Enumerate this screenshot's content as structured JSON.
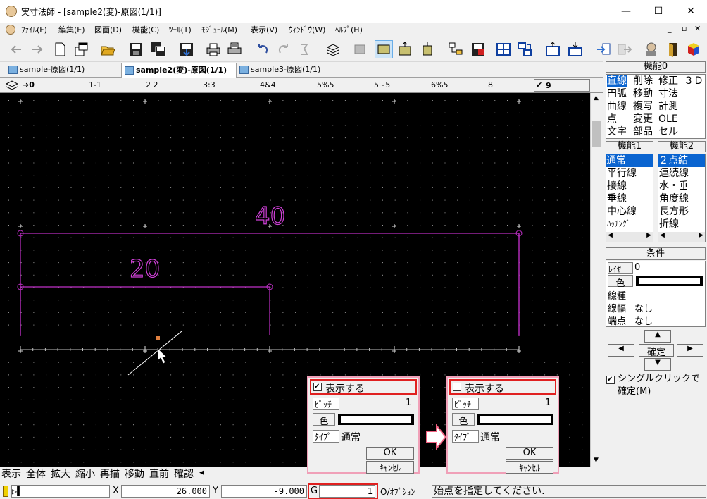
{
  "window": {
    "title": "実寸法師 - [sample2(変)-原図(1/1)]",
    "minimize_glyph": "—",
    "maximize_glyph": "☐",
    "close_glyph": "✕"
  },
  "menu": {
    "items": [
      "ﾌｧｲﾙ(F)",
      "編集(E)",
      "図面(D)",
      "機能(C)",
      "ﾂｰﾙ(T)",
      "ﾓｼﾞｭｰﾙ(M)",
      "表示(V)",
      "ｳｨﾝﾄﾞｳ(W)",
      "ﾍﾙﾌﾟ(H)"
    ],
    "mdi_controls": [
      "_",
      "▫",
      "✕"
    ]
  },
  "toolbar": {
    "icons": [
      "back-icon",
      "forward-icon",
      "new-icon",
      "new-window-icon",
      "open-icon",
      "save-icon",
      "save-all-icon",
      "export-icon",
      "print-icon",
      "print-preview-icon",
      "undo-icon",
      "redo-icon",
      "repeat-icon",
      "layers-icon",
      "fill-icon",
      "area-icon",
      "area-move-icon",
      "area-copy-icon",
      "tree-icon",
      "save-special-icon",
      "grid-icon",
      "hierarchy-icon",
      "window-up-icon",
      "window-down-icon",
      "import-icon",
      "send-icon",
      "user-icon",
      "exit-icon",
      "cube-icon"
    ]
  },
  "tabs": [
    {
      "label": "sample-原図(1/1)"
    },
    {
      "label": "sample2(変)-原図(1/1)"
    },
    {
      "label": "sample3-原図(1/1)"
    }
  ],
  "layers": {
    "items": [
      "0",
      "1-1",
      "2 2",
      "3:3",
      "4&4",
      "5%5",
      "5~5",
      "6%5",
      "8",
      "9"
    ],
    "current": "0",
    "checked": "9"
  },
  "drawing": {
    "dim_top": "40",
    "dim_inner": "20",
    "line_color": "#c030c8",
    "dim_color": "#d040d8"
  },
  "panel": {
    "func0": {
      "title": "機能0",
      "rows": [
        [
          "直線",
          "削除",
          "修正",
          "３Ｄ"
        ],
        [
          "円弧",
          "移動",
          "寸法",
          ""
        ],
        [
          "曲線",
          "複写",
          "計測",
          ""
        ],
        [
          "点",
          "変更",
          "OLE",
          ""
        ],
        [
          "文字",
          "部品",
          "セル",
          ""
        ]
      ]
    },
    "func1": {
      "title": "機能1",
      "items": [
        "通常",
        "平行線",
        "接線",
        "垂線",
        "中心線",
        "ﾊｯﾁﾝｸﾞ"
      ]
    },
    "func2": {
      "title": "機能2",
      "items": [
        "２点結",
        "連続線",
        "水・垂",
        "角度線",
        "長方形",
        "折線"
      ]
    },
    "cond": {
      "title": "条件",
      "layer_label": "ﾚｲﾔ",
      "layer_value": "0",
      "color_label": "色",
      "linetype_label": "線種",
      "linewidth_label": "線幅",
      "linewidth_value": "なし",
      "endpoint_label": "端点",
      "endpoint_value": "なし"
    },
    "nav": {
      "up": "▲",
      "left": "◀",
      "confirm": "確定",
      "right": "▶",
      "down": "▼"
    },
    "single_click": "シングルクリックで確定(M)"
  },
  "commands": [
    "表示",
    "全体",
    "拡大",
    "縮小",
    "再描",
    "移動",
    "直前",
    "確認"
  ],
  "status": {
    "x_label": "X",
    "x_value": "26.000",
    "y_label": "Y",
    "y_value": "-9.000",
    "g_label": "G",
    "g_value": "1",
    "option_label": "O/ｵﾌﾟｼｮﾝ",
    "message": "始点を指定してください."
  },
  "dialogs": [
    {
      "show_label": "表示する",
      "checked": true,
      "pitch_label": "ﾋﾟｯﾁ",
      "pitch_value": "1",
      "color_label": "色",
      "type_label": "ﾀｲﾌﾟ",
      "type_value": "通常",
      "ok": "OK",
      "cancel": "ｷｬﾝｾﾙ"
    },
    {
      "show_label": "表示する",
      "checked": false,
      "pitch_label": "ﾋﾟｯﾁ",
      "pitch_value": "1",
      "color_label": "色",
      "type_label": "ﾀｲﾌﾟ",
      "type_value": "通常",
      "ok": "OK",
      "cancel": "ｷｬﾝｾﾙ"
    }
  ],
  "colors": {
    "highlight_red": "#e02020",
    "dialog_border": "#f0a0b8",
    "arrow": "#f06080",
    "selection": "#0a64d0"
  }
}
